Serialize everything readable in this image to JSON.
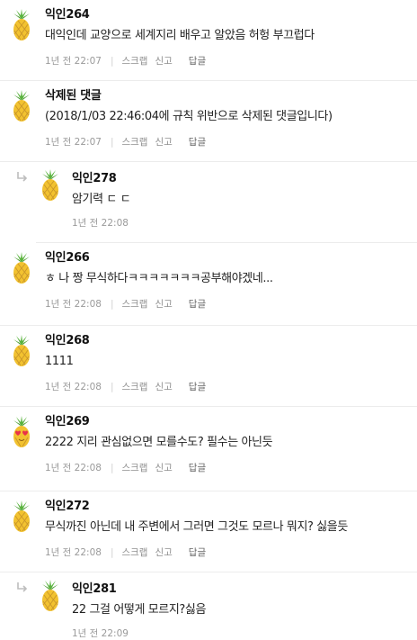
{
  "comments": [
    {
      "nick": "익인264",
      "text": "대익인데 교양으로 세계지리 배우고 알았음 허헝 부끄럽다",
      "time": "1년 전 22:07",
      "avatar": "pineapple-icon",
      "reply": false
    },
    {
      "nick": "삭제된 댓글",
      "text": "(2018/1/03 22:46:04에 규칙 위반으로 삭제된 댓글입니다)",
      "time": "1년 전 22:07",
      "avatar": "pineapple-icon",
      "reply": false
    },
    {
      "nick": "익인278",
      "text": "암기력 ㄷ ㄷ",
      "time": "1년 전 22:08",
      "avatar": "pineapple-icon",
      "reply": true
    },
    {
      "nick": "익인266",
      "text": "ㅎ 나 짱 무식하다ㅋㅋㅋㅋㅋㅋㅋ공부해야겠네...",
      "time": "1년 전 22:08",
      "avatar": "pineapple-icon",
      "reply": false
    },
    {
      "nick": "익인268",
      "text": "1111",
      "time": "1년 전 22:08",
      "avatar": "pineapple-icon",
      "reply": false
    },
    {
      "nick": "익인269",
      "text": "2222 지리 관심없으면 모를수도? 필수는 아닌듯",
      "time": "1년 전 22:08",
      "avatar": "pineapple-heart-eyes-icon",
      "reply": false
    },
    {
      "nick": "익인272",
      "text": "무식까진 아닌데 내 주변에서 그러면 그것도 모르나 뭐지? 싫을듯",
      "time": "1년 전 22:08",
      "avatar": "pineapple-icon",
      "reply": false
    },
    {
      "nick": "익인281",
      "text": "22 그걸 어떻게 모르지?싫음",
      "time": "1년 전 22:09",
      "avatar": "pineapple-icon",
      "reply": true
    }
  ],
  "actions": {
    "scrap": "스크랩",
    "report": "신고",
    "reply": "답글"
  },
  "colors": {
    "pineapple_body": "#f2c230",
    "pineapple_leaf": "#58b23c",
    "heart": "#e8324a"
  }
}
